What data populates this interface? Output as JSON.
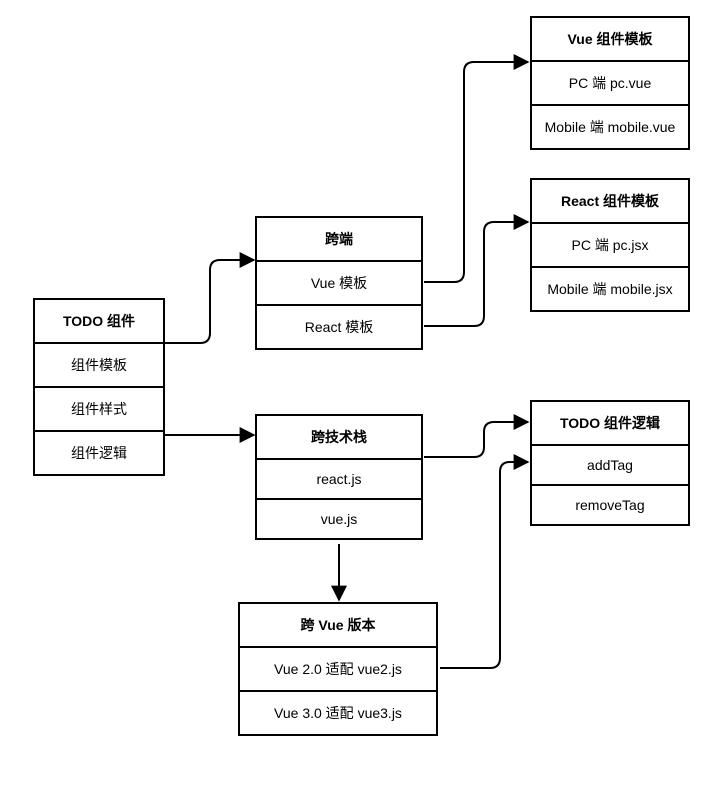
{
  "nodes": {
    "todo_component": {
      "title": "TODO 组件",
      "rows": [
        "组件模板",
        "组件样式",
        "组件逻辑"
      ]
    },
    "cross_platform": {
      "title": "跨端",
      "rows": [
        "Vue 模板",
        "React 模板"
      ]
    },
    "vue_tpl": {
      "title": "Vue 组件模板",
      "rows": [
        "PC 端 pc.vue",
        "Mobile 端 mobile.vue"
      ]
    },
    "react_tpl": {
      "title": "React 组件模板",
      "rows": [
        "PC 端 pc.jsx",
        "Mobile 端 mobile.jsx"
      ]
    },
    "cross_stack": {
      "title": "跨技术栈",
      "rows": [
        "react.js",
        "vue.js"
      ]
    },
    "todo_logic": {
      "title": "TODO 组件逻辑",
      "rows": [
        "addTag",
        "removeTag"
      ]
    },
    "cross_vue_ver": {
      "title": "跨 Vue 版本",
      "rows": [
        "Vue 2.0 适配 vue2.js",
        "Vue 3.0 适配 vue3.js"
      ]
    }
  }
}
